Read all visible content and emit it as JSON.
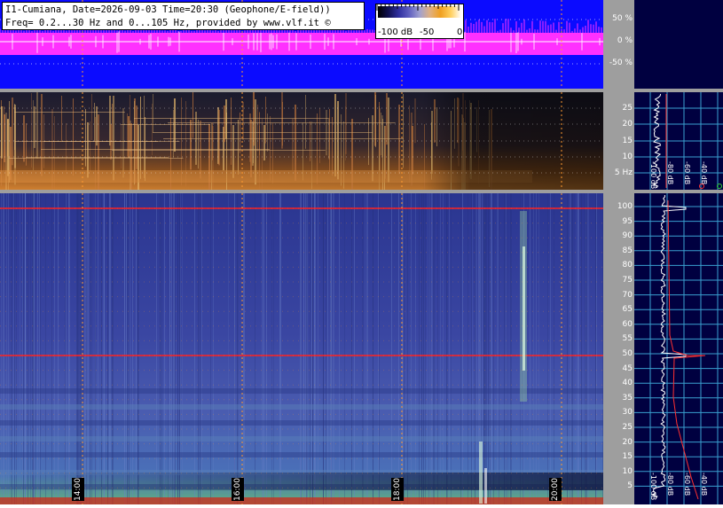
{
  "header": {
    "line1": "I1-Cumiana, Date=2026-09-03 Time=20:30 (Geophone/E-field))",
    "line2": "Freq= 0.2...30 Hz and 0...105 Hz, provided by www.vlf.it ©"
  },
  "colorbar": {
    "labels": [
      "-100 dB",
      "-50",
      "0"
    ]
  },
  "waveform_axis": {
    "ticks": [
      "50 %",
      "0 %",
      "-50 %"
    ]
  },
  "low_freq_axis": {
    "ticks": [
      "25",
      "20",
      "15",
      "10",
      "5 Hz"
    ]
  },
  "main_freq_axis": {
    "ticks": [
      "100",
      "95",
      "90",
      "85",
      "80",
      "75",
      "70",
      "65",
      "60",
      "55",
      "50",
      "45",
      "40",
      "35",
      "30",
      "25",
      "20",
      "15",
      "10",
      "5"
    ]
  },
  "time_axis": {
    "labels": [
      "14:00",
      "16:00",
      "18:00",
      "20:00"
    ]
  },
  "spectrum_side_labels": {
    "upper": [
      "-100 dB",
      "-80 dB",
      "-60 dB",
      "-40 dB",
      "-20 dB"
    ],
    "lower": [
      "-100 dB",
      "-80 dB",
      "-60 dB",
      "-40 dB",
      "-20 dB"
    ]
  },
  "colors": {
    "waveform_bg": "#0b0bff",
    "waveform_trace": "#ff30ff",
    "spectrogram_bg": "#3a45a0",
    "mains_line": "#ff2020",
    "grid_orange": "#ff9a30",
    "side_bg": "#000040"
  }
}
